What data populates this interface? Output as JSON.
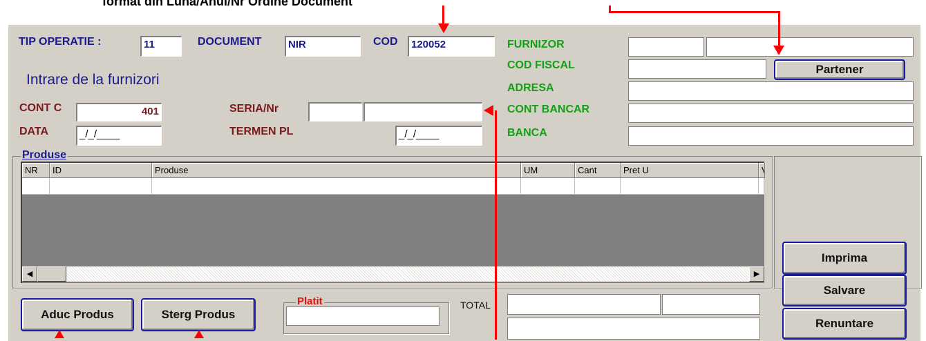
{
  "caption": "format din Luna/Anul/Nr Ordine Document",
  "header": {
    "tip_operatie_label": "TIP OPERATIE :",
    "tip_operatie_value": "11",
    "document_label": "DOCUMENT",
    "document_value": "NIR",
    "cod_label": "COD",
    "cod_value": "120052",
    "subtitle": "Intrare de la furnizori"
  },
  "partner": {
    "furnizor_label": "FURNIZOR",
    "cod_fiscal_label": "COD FISCAL",
    "adresa_label": "ADRESA",
    "cont_bancar_label": "CONT BANCAR",
    "banca_label": "BANCA",
    "partener_button": "Partener"
  },
  "details": {
    "cont_c_label": "CONT C",
    "cont_c_value": "401",
    "data_label": "DATA",
    "data_value": "_/_/____",
    "seria_label": "SERIA/Nr",
    "termen_label": "TERMEN PL",
    "termen_value": "_/_/____"
  },
  "products": {
    "group_label": "Produse",
    "columns": [
      "NR",
      "ID",
      "Produse",
      "UM",
      "Cant",
      "Pret U",
      "Va"
    ]
  },
  "footer": {
    "aduc_button": "Aduc Produs",
    "sterg_button": "Sterg Produs",
    "platit_label": "Platit",
    "total_label": "TOTAL",
    "imprima_button": "Imprima",
    "salvare_button": "Salvare",
    "renuntare_button": "Renuntare"
  },
  "colors": {
    "arrow": "#ff0000",
    "label_blue": "#1a1a8c",
    "label_green": "#14a014",
    "label_maroon": "#7a1a1a"
  }
}
